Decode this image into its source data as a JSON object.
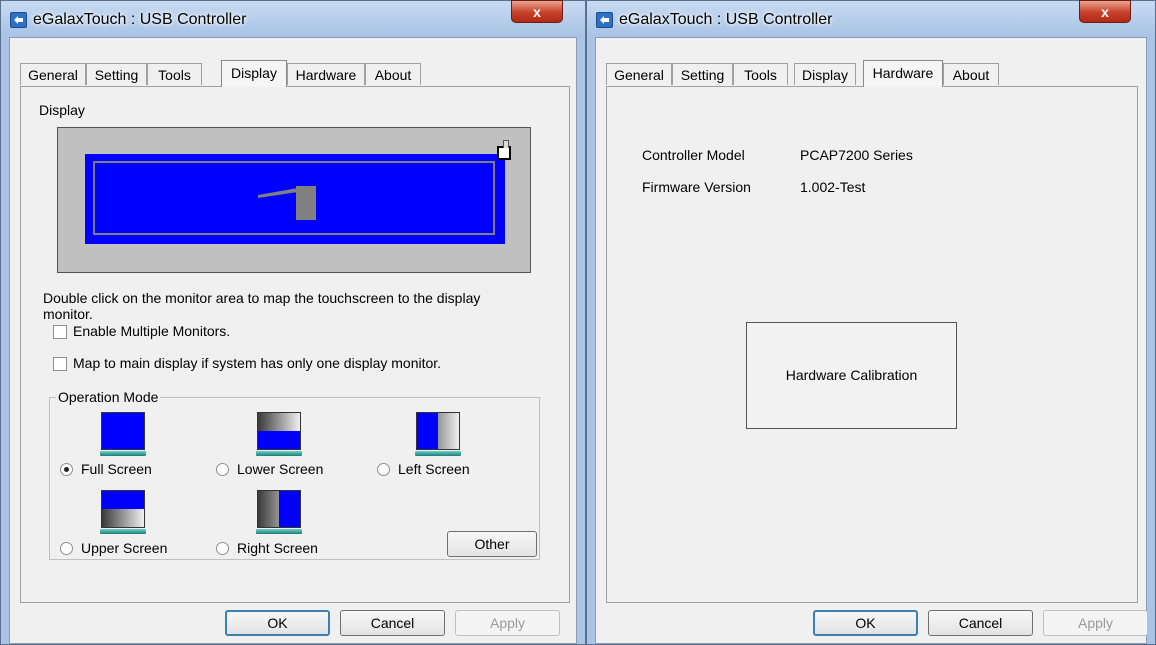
{
  "left_window": {
    "title": "eGalaxTouch : USB Controller",
    "close_label": "x",
    "tabs": [
      "General",
      "Setting",
      "Tools",
      "Display",
      "Hardware",
      "About"
    ],
    "active_tab": "Display",
    "display_label": "Display",
    "instruction_line1": "Double click on the monitor area to map the touchscreen to the display",
    "instruction_line2": "monitor.",
    "enable_multiple": "Enable Multiple Monitors.",
    "map_main": "Map to main display if system has only one display monitor.",
    "operation_mode_label": "Operation Mode",
    "modes": {
      "full": "Full Screen",
      "lower": "Lower Screen",
      "left": "Left Screen",
      "upper": "Upper Screen",
      "right": "Right Screen"
    },
    "selected_mode": "Full Screen",
    "other_button": "Other",
    "ok": "OK",
    "cancel": "Cancel",
    "apply": "Apply"
  },
  "right_window": {
    "title": "eGalaxTouch : USB Controller",
    "close_label": "x",
    "tabs": [
      "General",
      "Setting",
      "Tools",
      "Display",
      "Hardware",
      "About"
    ],
    "active_tab": "Hardware",
    "controller_model_label": "Controller Model",
    "controller_model_value": "PCAP7200 Series",
    "firmware_version_label": "Firmware Version",
    "firmware_version_value": "1.002-Test",
    "calibration_button": "Hardware Calibration",
    "ok": "OK",
    "cancel": "Cancel",
    "apply": "Apply"
  },
  "colors": {
    "monitor_blue": "#0000ff",
    "preview_gray": "#c0c0c0",
    "frame": "#a9c4e6",
    "close_red": "#c7402a"
  }
}
